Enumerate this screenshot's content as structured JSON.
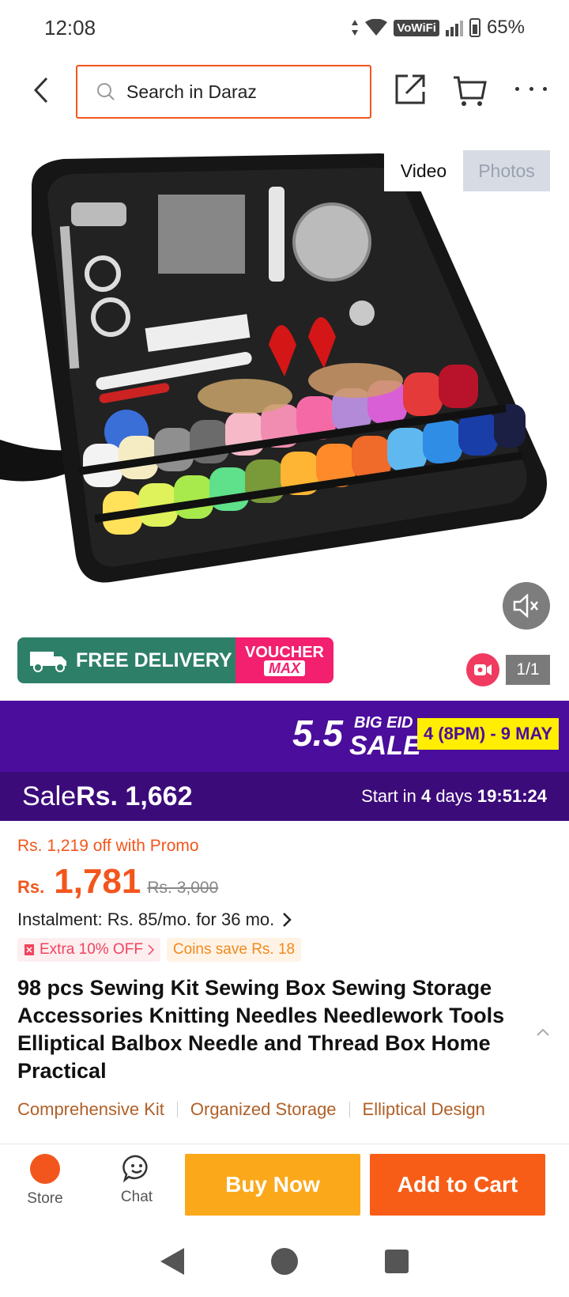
{
  "status_bar": {
    "time": "12:08",
    "network_label": "VoWiFi",
    "battery": "65%"
  },
  "header": {
    "search_placeholder": "Search in Daraz"
  },
  "gallery": {
    "tabs": [
      "Video",
      "Photos"
    ],
    "active_tab": "Video",
    "page_indicator": "1/1",
    "free_delivery_label": "FREE DELIVERY",
    "free_tag": "FREE",
    "voucher_label_1": "VOUCHER",
    "voucher_label_2": "MAX"
  },
  "campaign": {
    "number": "5.5",
    "line1": "BIG EID",
    "line2": "SALE",
    "dates": "4 (8PM) - 9 MAY"
  },
  "sale_bar": {
    "sale_word": "Sale",
    "sale_price": "Rs. 1,662",
    "start_prefix": "Start in",
    "days": "4",
    "days_word": "days",
    "countdown": "19:51:24"
  },
  "pricing": {
    "promo_text": "Rs. 1,219 off with Promo",
    "currency": "Rs.",
    "price": "1,781",
    "original_price": "Rs. 3,000",
    "instalment": "Instalment: Rs. 85/mo. for 36 mo.",
    "tag_extra": "Extra 10% OFF",
    "tag_coins": "Coins save Rs. 18"
  },
  "product": {
    "title": "98 pcs Sewing Kit Sewing Box Sewing Storage Accessories Knitting Needles Needlework Tools Elliptical Balbox Needle and Thread Box Home Practical",
    "highlights": [
      "Comprehensive Kit",
      "Organized Storage",
      "Elliptical Design"
    ]
  },
  "actions": {
    "store_label": "Store",
    "chat_label": "Chat",
    "buy_now": "Buy Now",
    "add_to_cart": "Add to Cart"
  },
  "colors": {
    "brand_orange": "#f2561d",
    "campaign_purple": "#4b0d9c",
    "buy_now_yellow": "#fba81b",
    "add_cart_orange": "#f75d16",
    "free_delivery_green": "#2e7f68",
    "voucher_pink": "#f2206e"
  },
  "icons": [
    "back-arrow-icon",
    "search-icon",
    "share-icon",
    "cart-icon",
    "more-icon",
    "mute-icon",
    "video-icon",
    "chevron-right-icon",
    "chevron-up-icon",
    "chat-icon",
    "store-logo"
  ]
}
